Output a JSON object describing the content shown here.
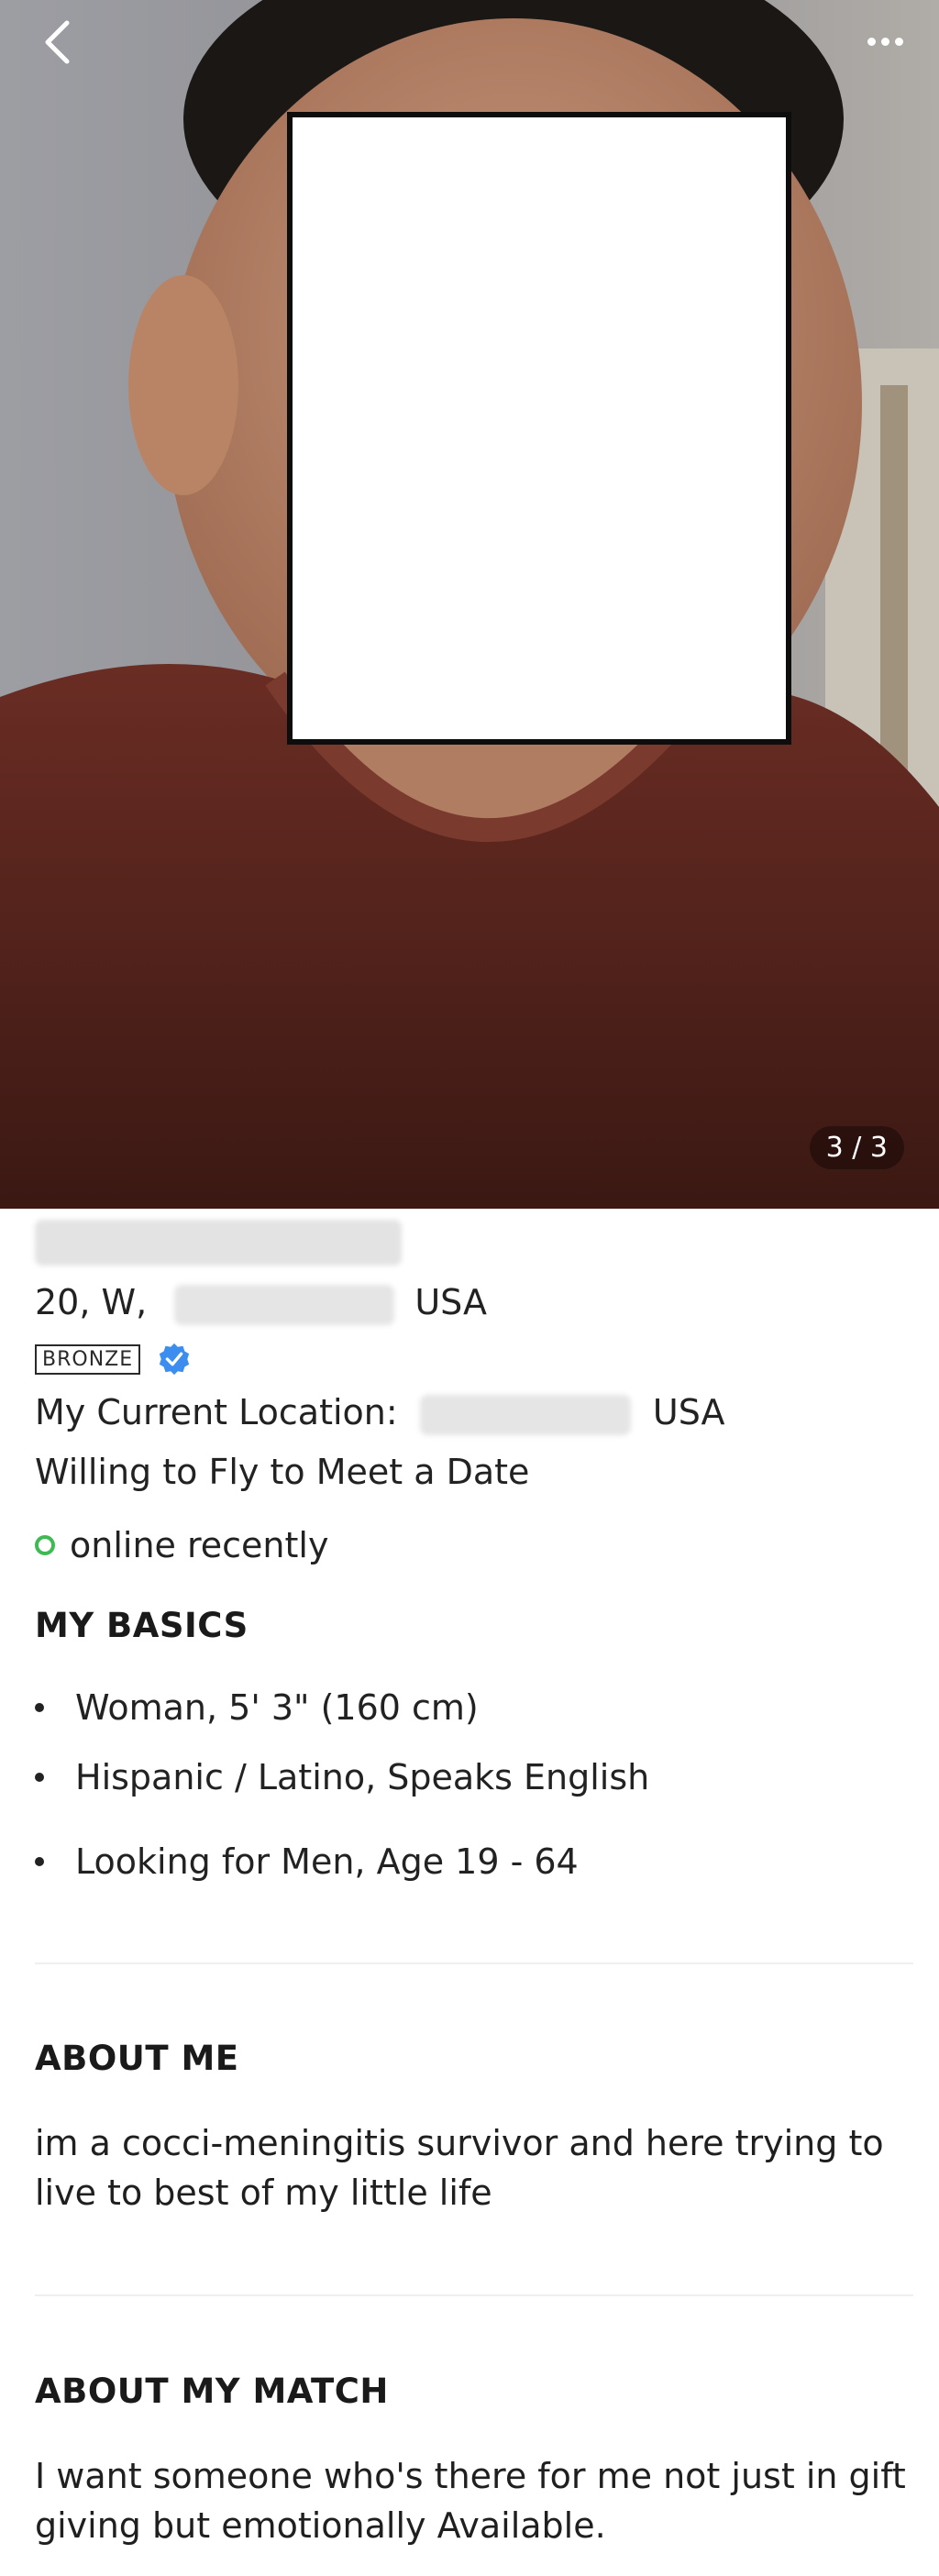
{
  "header": {
    "back_icon": "chevron-left-icon",
    "more_icon": "more-dots-icon",
    "photo_counter": "3 / 3"
  },
  "profile": {
    "age_gender": "20, W,",
    "country": "USA",
    "membership_badge": "BRONZE",
    "verified_icon": "verified-check-icon",
    "current_location_label": "My Current Location:",
    "current_location_country": "USA",
    "travel": "Willing to Fly to Meet a Date",
    "status": "online recently"
  },
  "basics": {
    "title": "MY BASICS",
    "items": [
      "Woman, 5' 3\" (160 cm)",
      "Hispanic / Latino, Speaks English",
      "Looking for Men, Age 19 - 64"
    ]
  },
  "about_me": {
    "title": "ABOUT ME",
    "text": "im a cocci-meningitis survivor and here trying to live to best of my little life"
  },
  "about_match": {
    "title": "ABOUT MY MATCH",
    "text": "I want someone who's there for me not just in gift giving but emotionally Available."
  },
  "colors": {
    "online": "#3dbb52",
    "verified": "#3b8ef0"
  }
}
